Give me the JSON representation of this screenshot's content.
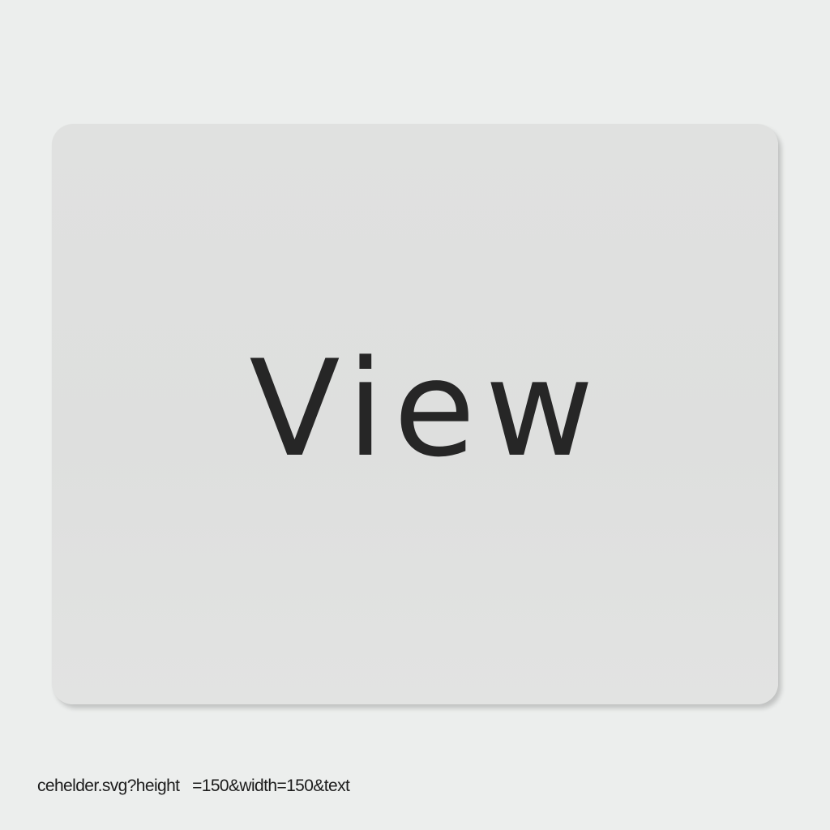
{
  "card": {
    "label": "View"
  },
  "caption": {
    "text": "cehelder.svg?height   =150&width=150&text"
  },
  "colors": {
    "background": "#eceeed",
    "card": "#dfe0df",
    "text": "#262626"
  }
}
